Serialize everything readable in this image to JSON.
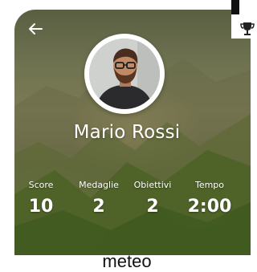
{
  "profile": {
    "name": "Mario Rossi"
  },
  "stats": [
    {
      "label": "Score",
      "value": "10"
    },
    {
      "label": "Medaglie",
      "value": "2"
    },
    {
      "label": "Obiettivi",
      "value": "2"
    },
    {
      "label": "Tempo",
      "value": "2:00"
    }
  ],
  "footer": {
    "label": "meteo"
  },
  "icons": {
    "back": "arrow-left-icon",
    "trophy": "trophy-icon"
  },
  "colors": {
    "text_on_card": "#ffffff",
    "footer_text": "#111111"
  }
}
